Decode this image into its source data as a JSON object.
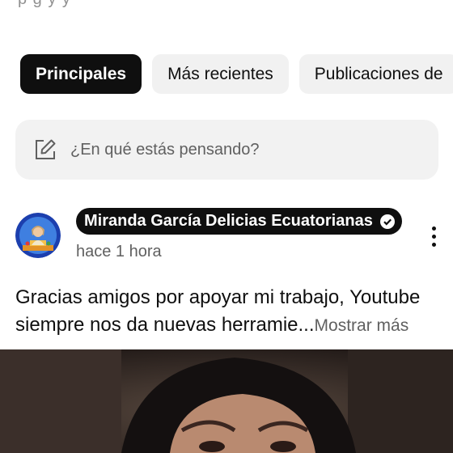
{
  "header": {
    "fragment": "p     g     y              y"
  },
  "filters": [
    {
      "label": "Principales",
      "active": true
    },
    {
      "label": "Más recientes",
      "active": false
    },
    {
      "label": "Publicaciones de",
      "active": false
    }
  ],
  "composer": {
    "placeholder": "¿En qué estás pensando?",
    "icon": "edit-icon"
  },
  "post": {
    "author": "Miranda García Delicias Ecuatorianas",
    "verified": true,
    "time": "hace 1 hora",
    "text": "Gracias amigos por apoyar mi trabajo, Youtube siempre nos da nuevas herramie...",
    "show_more": "Mostrar más"
  },
  "colors": {
    "accent": "#0f0f0f",
    "chip_bg": "#f1f1f1",
    "secondary_text": "#606060"
  }
}
